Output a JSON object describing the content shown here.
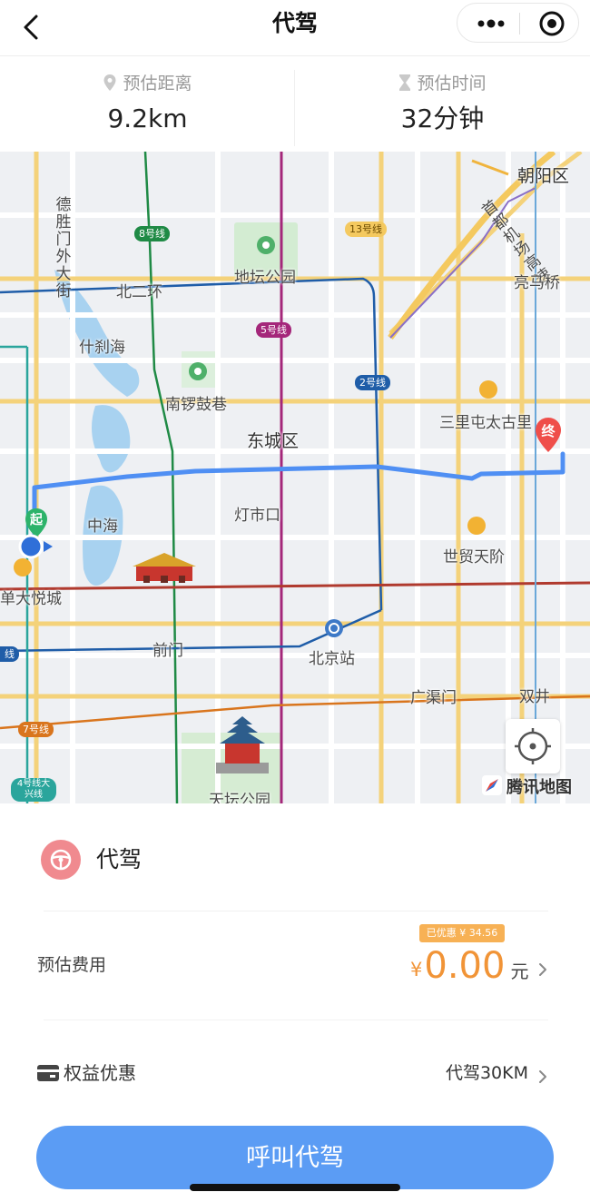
{
  "header": {
    "title": "代驾"
  },
  "estimate": {
    "distance_label": "预估距离",
    "distance_value": "9.2km",
    "time_label": "预估时间",
    "time_value": "32分钟"
  },
  "map": {
    "labels": {
      "chaoyang": "朝阳区",
      "deshengmen": "德胜门外大街",
      "line8": "8号线",
      "line13": "13号线",
      "airport_expressway": "首都机场高速",
      "ditan": "地坛公园",
      "bei_er_huan": "北二环",
      "liangmaqiao": "亮马桥",
      "shichahai": "什刹海",
      "line5": "5号线",
      "line2": "2号线",
      "nanluoguxiang": "南锣鼓巷",
      "sanlitun": "三里屯太古里",
      "dongcheng": "东城区",
      "start_marker": "起",
      "end_marker": "终",
      "dengshikou": "灯市口",
      "zhonghai": "中海",
      "shimao": "世贸天阶",
      "xidan": "单大悦城",
      "qianmen": "前门",
      "beijing_station": "北京站",
      "guangqumen": "广渠门",
      "shuangjing": "双井",
      "line7": "7号线",
      "line4": "4号线大兴线",
      "tiantan": "天坛公园",
      "line_left": "线"
    },
    "watermark": "腾讯地图",
    "colors": {
      "route": "#4f8ff3",
      "start": "#2db36a",
      "end": "#ef4e4a"
    }
  },
  "service": {
    "name": "代驾",
    "icon": "steering-wheel-icon"
  },
  "fee": {
    "label": "预估费用",
    "discount_badge": "已优惠 ¥ 34.56",
    "currency": "¥",
    "amount": "0.00",
    "unit": "元",
    "accent_color": "#f19437"
  },
  "benefit": {
    "label": "权益优惠",
    "value": "代驾30KM"
  },
  "call_button": {
    "label": "呼叫代驾",
    "color": "#5b9cf4"
  }
}
